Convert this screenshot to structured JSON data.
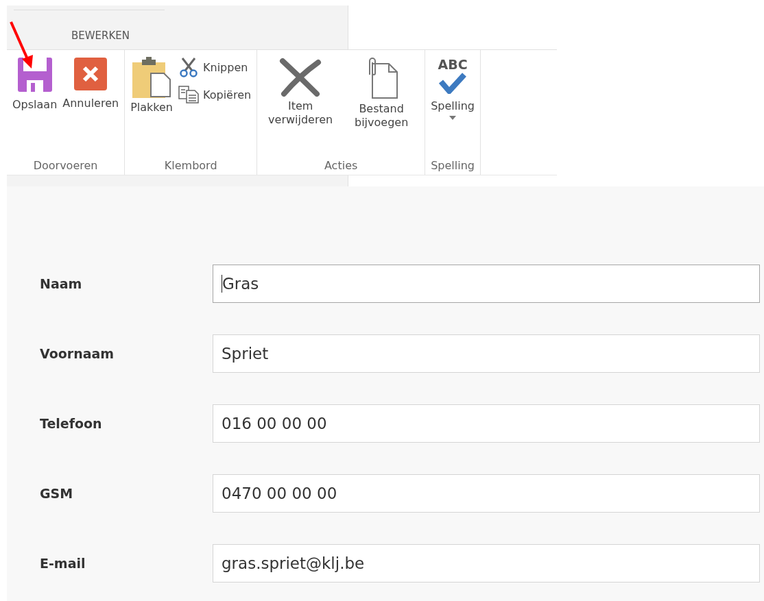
{
  "ribbon": {
    "tab": {
      "label": "BEWERKEN",
      "selected": true
    },
    "groups": [
      {
        "label": "Doorvoeren",
        "buttons": [
          {
            "kind": "large",
            "label": "Opslaan"
          },
          {
            "kind": "large",
            "label": "Annuleren"
          }
        ]
      },
      {
        "label": "Klembord",
        "buttons": [
          {
            "kind": "large",
            "label": "Plakken"
          },
          {
            "kind": "small",
            "label": "Knippen"
          },
          {
            "kind": "small",
            "label": "Kopiëren"
          }
        ]
      },
      {
        "label": "Acties",
        "buttons": [
          {
            "kind": "large",
            "label": "Item verwijderen"
          },
          {
            "kind": "large",
            "label": "Bestand bijvoegen"
          }
        ]
      },
      {
        "label": "Spelling",
        "buttons": [
          {
            "kind": "large",
            "label": "Spelling",
            "icon_text": "ABC",
            "dropdown": true
          }
        ]
      }
    ]
  },
  "form": {
    "fields": [
      {
        "label": "Naam",
        "value": "Gras",
        "focused": true
      },
      {
        "label": "Voornaam",
        "value": "Spriet",
        "focused": false
      },
      {
        "label": "Telefoon",
        "value": "016 00 00 00",
        "focused": false
      },
      {
        "label": "GSM",
        "value": "0470 00 00 00",
        "focused": false
      },
      {
        "label": "E-mail",
        "value": "gras.spriet@klj.be",
        "focused": false
      }
    ]
  }
}
